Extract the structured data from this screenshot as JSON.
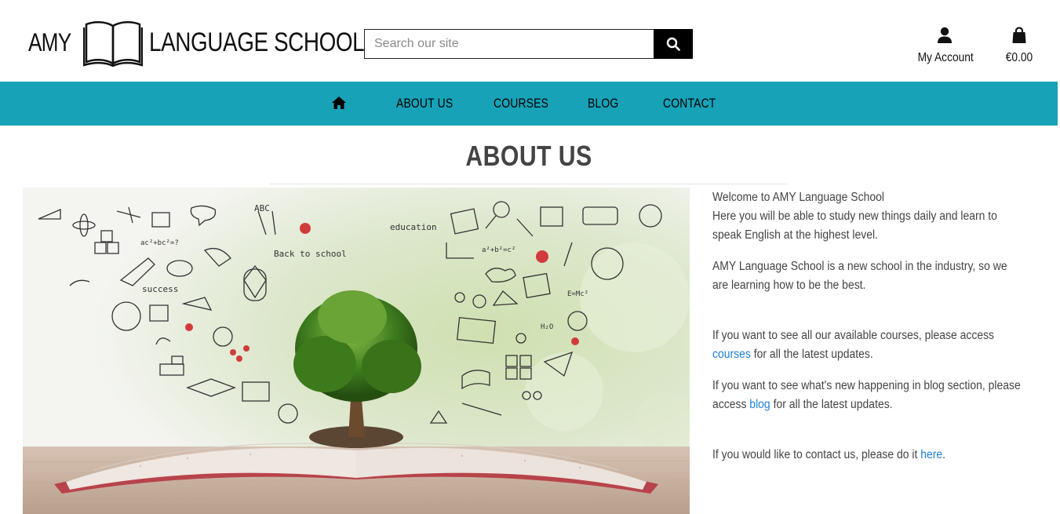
{
  "header": {
    "logo_left": "AMY",
    "logo_right": "LANGUAGE SCHOOL",
    "search_placeholder": "Search our site",
    "account_label": "My Account",
    "bag_total": "€0.00"
  },
  "nav": {
    "items": [
      {
        "label": "ABOUT US"
      },
      {
        "label": "COURSES"
      },
      {
        "label": "BLOG"
      },
      {
        "label": "CONTACT"
      }
    ]
  },
  "main": {
    "title": "ABOUT US",
    "welcome": "Welcome to AMY Language School",
    "intro": "Here you will be able to study new things daily and learn to speak English at the highest level.",
    "para2": "AMY Language School is a new school in the industry, so we are learning how to be the best.",
    "courses_pre": "If you want to see all our available courses, please access ",
    "courses_link": "courses",
    "courses_post": " for all the latest updates.",
    "blog_pre": "If you want to see what's new happening in blog section, please access ",
    "blog_link": "blog",
    "blog_post": " for all the latest updates.",
    "contact_pre": "If you would like to contact us, please do it ",
    "contact_link": "here",
    "contact_post": "."
  },
  "hero_doodles": {
    "abc": "ABC",
    "education": "education",
    "back_to_school": "Back to school",
    "success": "success",
    "formula1": "ac²+bc²=?",
    "formula2": "a²+b²=c²",
    "formula3": "E=Mc²",
    "h2o": "H₂O"
  },
  "icons": {
    "logo": "open-book-icon",
    "search": "search-icon",
    "account": "user-icon",
    "bag": "shopping-bag-icon",
    "home": "home-icon"
  },
  "colors": {
    "nav_bg": "#17a2b8",
    "link": "#1e7fd6",
    "search_button": "#000000"
  }
}
